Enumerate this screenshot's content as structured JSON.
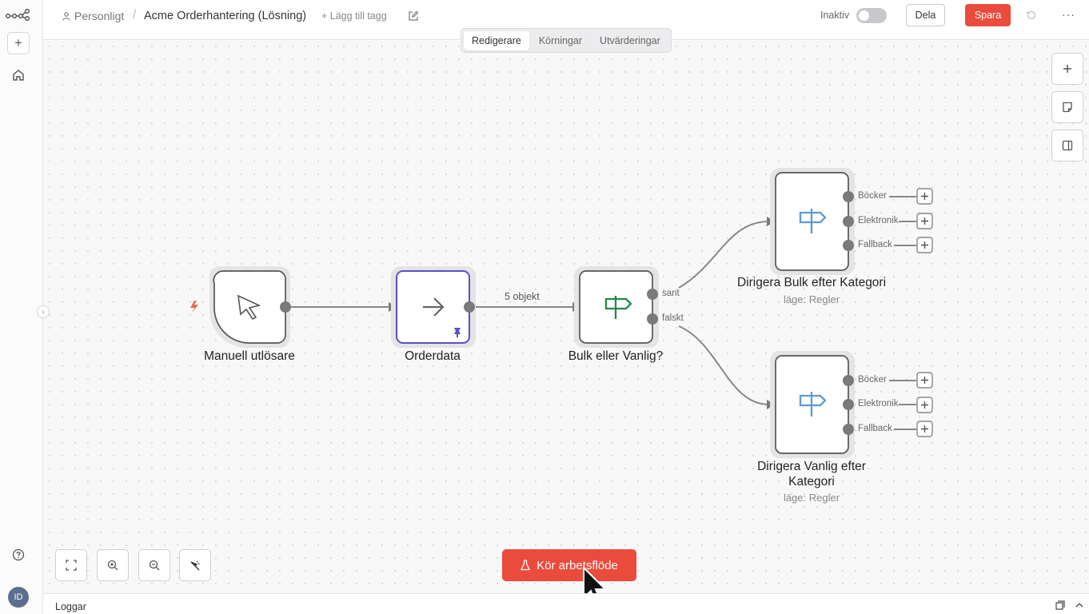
{
  "header": {
    "breadcrumb_home": "Personligt",
    "separator": "/",
    "workflow_title": "Acme Orderhantering (Lösning)",
    "add_tag": "+ Lägg till tagg",
    "active_label": "Inaktiv",
    "share_label": "Dela",
    "save_label": "Spara",
    "more": "···"
  },
  "tabs": [
    {
      "label": "Redigerare",
      "active": true
    },
    {
      "label": "Körningar",
      "active": false
    },
    {
      "label": "Utvärderingar",
      "active": false
    }
  ],
  "nodes": {
    "trigger": {
      "label": "Manuell utlösare"
    },
    "orderdata": {
      "label": "Orderdata"
    },
    "bulk_or_regular": {
      "label": "Bulk eller Vanlig?",
      "out_true": "sant",
      "out_false": "falskt"
    },
    "route_bulk": {
      "label": "Dirigera Bulk efter Kategori",
      "sub": "läge: Regler",
      "outputs": [
        "Böcker",
        "Elektronik",
        "Fallback"
      ]
    },
    "route_regular": {
      "label_line1": "Dirigera Vanlig efter",
      "label_line2": "Kategori",
      "sub": "läge: Regler",
      "outputs": [
        "Böcker",
        "Elektronik",
        "Fallback"
      ]
    }
  },
  "edge_label": "5 objekt",
  "run_button": "Kör arbetsflöde",
  "logs_label": "Loggar",
  "avatar_initials": "ID",
  "colors": {
    "accent": "#ea4b3c",
    "pinned_node_border": "#5a4fc4",
    "if_icon": "#1f8a4c",
    "switch_icon": "#5b9bd5"
  }
}
